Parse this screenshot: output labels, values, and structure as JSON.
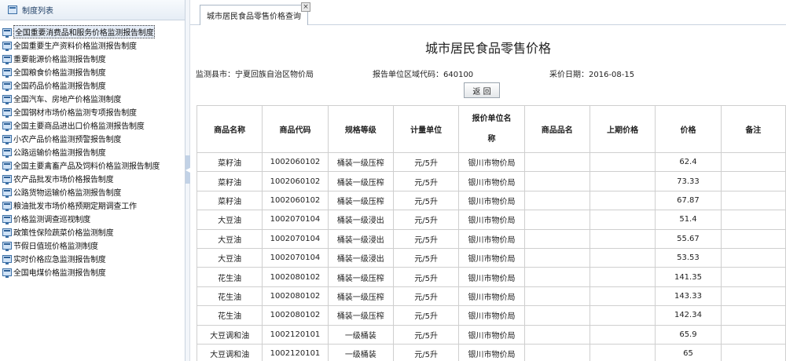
{
  "sidebar": {
    "title": "制度列表",
    "items": [
      {
        "label": "全国重要消费品和服务价格监测报告制度",
        "selected": true
      },
      {
        "label": "全国重要生产资料价格监测报告制度"
      },
      {
        "label": "重要能源价格监测报告制度"
      },
      {
        "label": "全国粮食价格监测报告制度"
      },
      {
        "label": "全国药品价格监测报告制度"
      },
      {
        "label": "全国汽车、房地产价格监测制度"
      },
      {
        "label": "全国钢材市场价格监测专项报告制度"
      },
      {
        "label": "全国主要商品进出口价格监测报告制度"
      },
      {
        "label": "小农产品价格监测预警报告制度"
      },
      {
        "label": "公路运输价格监测报告制度"
      },
      {
        "label": "全国主要禽畜产品及饲料价格监测报告制度"
      },
      {
        "label": "农产品批发市场价格报告制度"
      },
      {
        "label": "公路货物运输价格监测报告制度"
      },
      {
        "label": "粮油批发市场价格预期定期调查工作"
      },
      {
        "label": "价格监测调查巡视制度"
      },
      {
        "label": "政策性保险蔬菜价格监测制度"
      },
      {
        "label": "节假日值班价格监测制度"
      },
      {
        "label": "实时价格应急监测报告制度"
      },
      {
        "label": "全国电煤价格监测报告制度"
      }
    ]
  },
  "tab": {
    "label": "城市居民食品零售价格查询",
    "close": "×"
  },
  "page": {
    "title": "城市居民食品零售价格",
    "county": "监测县市：宁夏回族自治区物价局",
    "code": "报告单位区域代码：640100",
    "date": "采价日期：2016-08-15",
    "back_label": "返 回"
  },
  "table": {
    "headers": [
      "商品名称",
      "商品代码",
      "规格等级",
      "计量单位",
      "报价单位名称",
      "商品品名",
      "上期价格",
      "价格",
      "备注"
    ],
    "rows": [
      [
        "菜籽油",
        "1002060102",
        "桶装一级压榨",
        "元/5升",
        "银川市物价局",
        "",
        "",
        "62.4",
        ""
      ],
      [
        "菜籽油",
        "1002060102",
        "桶装一级压榨",
        "元/5升",
        "银川市物价局",
        "",
        "",
        "73.33",
        ""
      ],
      [
        "菜籽油",
        "1002060102",
        "桶装一级压榨",
        "元/5升",
        "银川市物价局",
        "",
        "",
        "67.87",
        ""
      ],
      [
        "大豆油",
        "1002070104",
        "桶装一级浸出",
        "元/5升",
        "银川市物价局",
        "",
        "",
        "51.4",
        ""
      ],
      [
        "大豆油",
        "1002070104",
        "桶装一级浸出",
        "元/5升",
        "银川市物价局",
        "",
        "",
        "55.67",
        ""
      ],
      [
        "大豆油",
        "1002070104",
        "桶装一级浸出",
        "元/5升",
        "银川市物价局",
        "",
        "",
        "53.53",
        ""
      ],
      [
        "花生油",
        "1002080102",
        "桶装一级压榨",
        "元/5升",
        "银川市物价局",
        "",
        "",
        "141.35",
        ""
      ],
      [
        "花生油",
        "1002080102",
        "桶装一级压榨",
        "元/5升",
        "银川市物价局",
        "",
        "",
        "143.33",
        ""
      ],
      [
        "花生油",
        "1002080102",
        "桶装一级压榨",
        "元/5升",
        "银川市物价局",
        "",
        "",
        "142.34",
        ""
      ],
      [
        "大豆调和油",
        "1002120101",
        "一级桶装",
        "元/5升",
        "银川市物价局",
        "",
        "",
        "65.9",
        ""
      ],
      [
        "大豆调和油",
        "1002120101",
        "一级桶装",
        "元/5升",
        "银川市物价局",
        "",
        "",
        "65",
        ""
      ]
    ]
  }
}
